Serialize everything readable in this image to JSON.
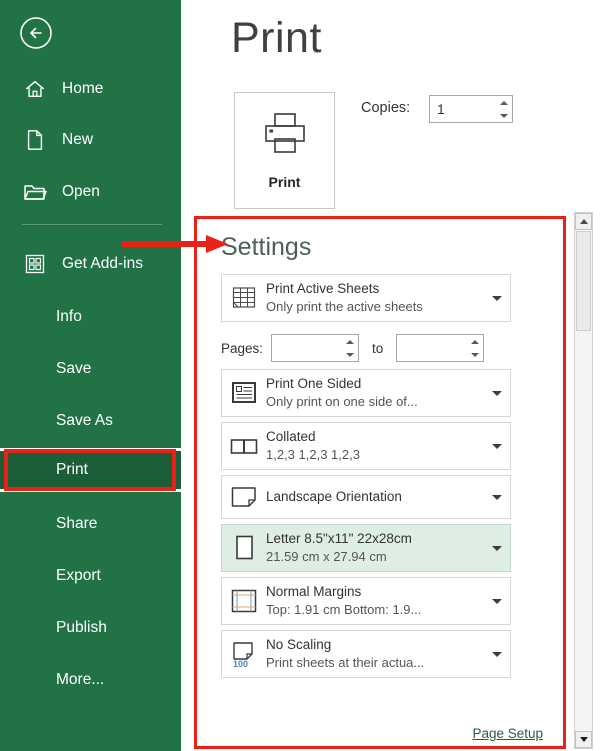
{
  "colors": {
    "sidebar_green": "#217346",
    "sidebar_active_green": "#1b5e38",
    "annotation_red": "#e82216",
    "row_highlight": "#dfeee5",
    "link_green": "#2b5c44"
  },
  "sidebar": {
    "back_button": "back-arrow-icon",
    "items": [
      {
        "label": "Home",
        "icon": "home-icon",
        "active": false
      },
      {
        "label": "New",
        "icon": "new-file-icon",
        "active": false
      },
      {
        "label": "Open",
        "icon": "folder-icon",
        "active": false
      },
      {
        "label": "Get Add-ins",
        "icon": "addins-grid-icon",
        "active": false
      },
      {
        "label": "Info",
        "icon": "",
        "active": false
      },
      {
        "label": "Save",
        "icon": "",
        "active": false
      },
      {
        "label": "Save As",
        "icon": "",
        "active": false
      },
      {
        "label": "Print",
        "icon": "",
        "active": true
      },
      {
        "label": "Share",
        "icon": "",
        "active": false
      },
      {
        "label": "Export",
        "icon": "",
        "active": false
      },
      {
        "label": "Publish",
        "icon": "",
        "active": false
      },
      {
        "label": "More...",
        "icon": "",
        "active": false
      }
    ]
  },
  "main": {
    "title": "Print",
    "print_button": {
      "label": "Print",
      "icon": "printer-icon"
    },
    "copies": {
      "label": "Copies:",
      "value": "1",
      "placeholder": ""
    }
  },
  "settings": {
    "title": "Settings",
    "page_setup_link": "Page Setup",
    "pages": {
      "label": "Pages:",
      "to_label": "to",
      "from_value": "",
      "to_value": "",
      "placeholder": ""
    },
    "rows": [
      {
        "icon": "sheet-grid-icon",
        "primary": "Print Active Sheets",
        "secondary": "Only print the active sheets",
        "highlighted": false
      },
      {
        "icon": "one-sided-page-icon",
        "primary": "Print One Sided",
        "secondary": "Only print on one side of...",
        "highlighted": false
      },
      {
        "icon": "collate-icon",
        "primary": "Collated",
        "secondary": "1,2,3    1,2,3    1,2,3",
        "highlighted": false
      },
      {
        "icon": "landscape-page-icon",
        "primary": "Landscape Orientation",
        "secondary": "",
        "highlighted": false
      },
      {
        "icon": "paper-size-icon",
        "primary": "Letter 8.5\"x11\" 22x28cm",
        "secondary": "21.59 cm x 27.94 cm",
        "highlighted": true
      },
      {
        "icon": "margins-icon",
        "primary": "Normal Margins",
        "secondary": "Top: 1.91 cm Bottom: 1.9...",
        "highlighted": false
      },
      {
        "icon": "scaling-100-icon",
        "primary": "No Scaling",
        "secondary": "Print sheets at their actua...",
        "highlighted": false
      }
    ],
    "scrollbar": {
      "up_icon": "scroll-up-arrow-icon",
      "down_icon": "scroll-down-arrow-icon"
    }
  },
  "annotations": {
    "arrow": "red-pointer-arrow",
    "print_box": "red-highlight-box-print",
    "settings_box": "red-highlight-box-settings"
  }
}
